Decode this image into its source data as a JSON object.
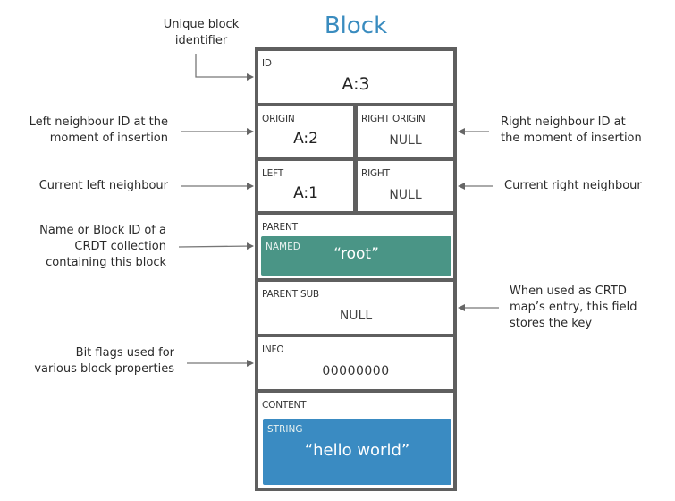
{
  "title": "Block",
  "fields": {
    "id": {
      "label": "ID",
      "value": "A:3"
    },
    "origin": {
      "label": "ORIGIN",
      "value": "A:2"
    },
    "right_origin": {
      "label": "RIGHT ORIGIN",
      "value": "NULL"
    },
    "left": {
      "label": "LEFT",
      "value": "A:1"
    },
    "right": {
      "label": "RIGHT",
      "value": "NULL"
    },
    "parent": {
      "label": "PARENT",
      "type": "NAMED",
      "value": "“root”",
      "color": "#4a9586"
    },
    "parent_sub": {
      "label": "PARENT SUB",
      "value": "NULL"
    },
    "info": {
      "label": "INFO",
      "value": "00000000"
    },
    "content": {
      "label": "CONTENT",
      "type": "STRING",
      "value": "“hello world”",
      "color": "#3a8bc2"
    }
  },
  "annotations": {
    "id": "Unique block\nidentifier",
    "origin": "Left neighbour ID at the\nmoment of insertion",
    "left": "Current left neighbour",
    "parent": "Name or Block ID of a\nCRDT collection\ncontaining this block",
    "info": "Bit flags used for\nvarious block properties",
    "right_origin": "Right neighbour ID at\nthe moment of insertion",
    "right": "Current right neighbour",
    "parent_sub": "When used as CRTD\nmap’s entry, this field\nstores the key"
  },
  "colors": {
    "title": "#3a8cbf",
    "border": "#5f5f5f",
    "arrow": "#666666"
  }
}
